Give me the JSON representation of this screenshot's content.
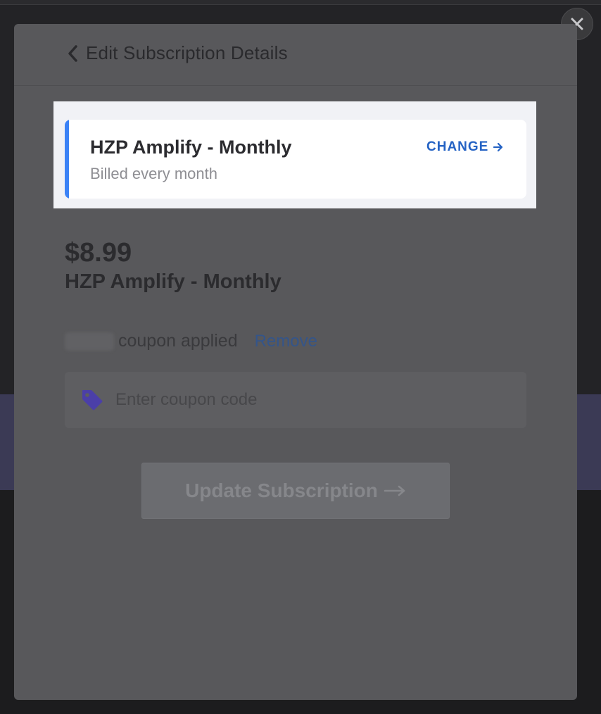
{
  "header": {
    "back_icon": "chevron-left-icon",
    "title": "Edit Subscription Details"
  },
  "close": {
    "icon": "close-icon"
  },
  "plan_card": {
    "name": "HZP Amplify - Monthly",
    "billing": "Billed every month",
    "change_label": "CHANGE",
    "change_icon": "arrow-right-icon",
    "accent_color": "#3b82f6"
  },
  "summary": {
    "price": "$8.99",
    "plan_name": "HZP Amplify - Monthly"
  },
  "coupon": {
    "applied_text": "coupon applied",
    "remove_label": "Remove",
    "icon": "tag-icon",
    "placeholder": "Enter coupon code",
    "value": ""
  },
  "actions": {
    "update_label": "Update Subscription",
    "update_icon": "long-arrow-right-icon"
  }
}
